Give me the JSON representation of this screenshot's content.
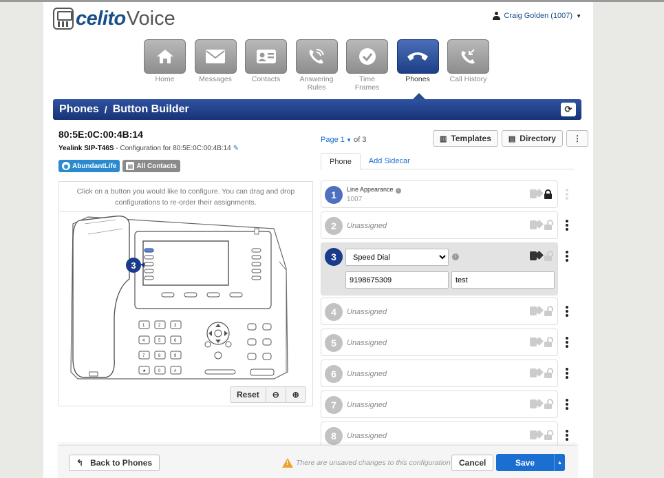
{
  "header": {
    "logo_brand": "celito",
    "logo_product": "Voice",
    "user_name": "Craig Golden (1007)"
  },
  "nav": [
    {
      "label": "Home",
      "icon": "home-icon",
      "active": false
    },
    {
      "label": "Messages",
      "icon": "envelope-icon",
      "active": false
    },
    {
      "label": "Contacts",
      "icon": "contact-card-icon",
      "active": false
    },
    {
      "label": "Answering Rules",
      "icon": "phone-forward-icon",
      "active": false
    },
    {
      "label": "Time Frames",
      "icon": "clock-icon",
      "active": false
    },
    {
      "label": "Phones",
      "icon": "phone-handset-icon",
      "active": true
    },
    {
      "label": "Call History",
      "icon": "call-history-icon",
      "active": false
    }
  ],
  "title": {
    "section": "Phones",
    "separator": "/",
    "page": "Button Builder"
  },
  "device": {
    "mac": "80:5E:0C:00:4B:14",
    "model": "Yealink SIP-T46S",
    "config_text": " - Configuration for 80:5E:0C:00:4B:14",
    "tags": [
      "AbundantLife",
      "All Contacts"
    ]
  },
  "canvas": {
    "hint": "Click on a button you would like to configure. You can drag and drop configurations to re-order their assignments.",
    "selected_key": "3",
    "controls": {
      "reset": "Reset",
      "zoom_out": "−",
      "zoom_in": "+"
    }
  },
  "pager": {
    "prefix": "Page",
    "page": "1",
    "of_text": "of 3"
  },
  "toolbar": {
    "templates": "Templates",
    "directory": "Directory"
  },
  "tabs": [
    {
      "label": "Phone",
      "active": true
    },
    {
      "label": "Add Sidecar",
      "active": false
    }
  ],
  "buttons": [
    {
      "num": "1",
      "label": "Line Appearance",
      "value": "1007",
      "state": "line"
    },
    {
      "num": "2",
      "text": "Unassigned"
    },
    {
      "num": "3",
      "type": "Speed Dial",
      "number": "9198675309",
      "name": "test",
      "state": "editing"
    },
    {
      "num": "4",
      "text": "Unassigned"
    },
    {
      "num": "5",
      "text": "Unassigned"
    },
    {
      "num": "6",
      "text": "Unassigned"
    },
    {
      "num": "7",
      "text": "Unassigned"
    },
    {
      "num": "8",
      "text": "Unassigned"
    }
  ],
  "speed_dial_options": [
    "Speed Dial"
  ],
  "footer": {
    "back": "Back to Phones",
    "warning": "There are unsaved changes to this configuration",
    "cancel": "Cancel",
    "save": "Save"
  },
  "colors": {
    "brand": "#1a4e8a",
    "accent": "#1a6fd0",
    "header_bar": "#1f3f86",
    "warning": "#f0a030"
  }
}
